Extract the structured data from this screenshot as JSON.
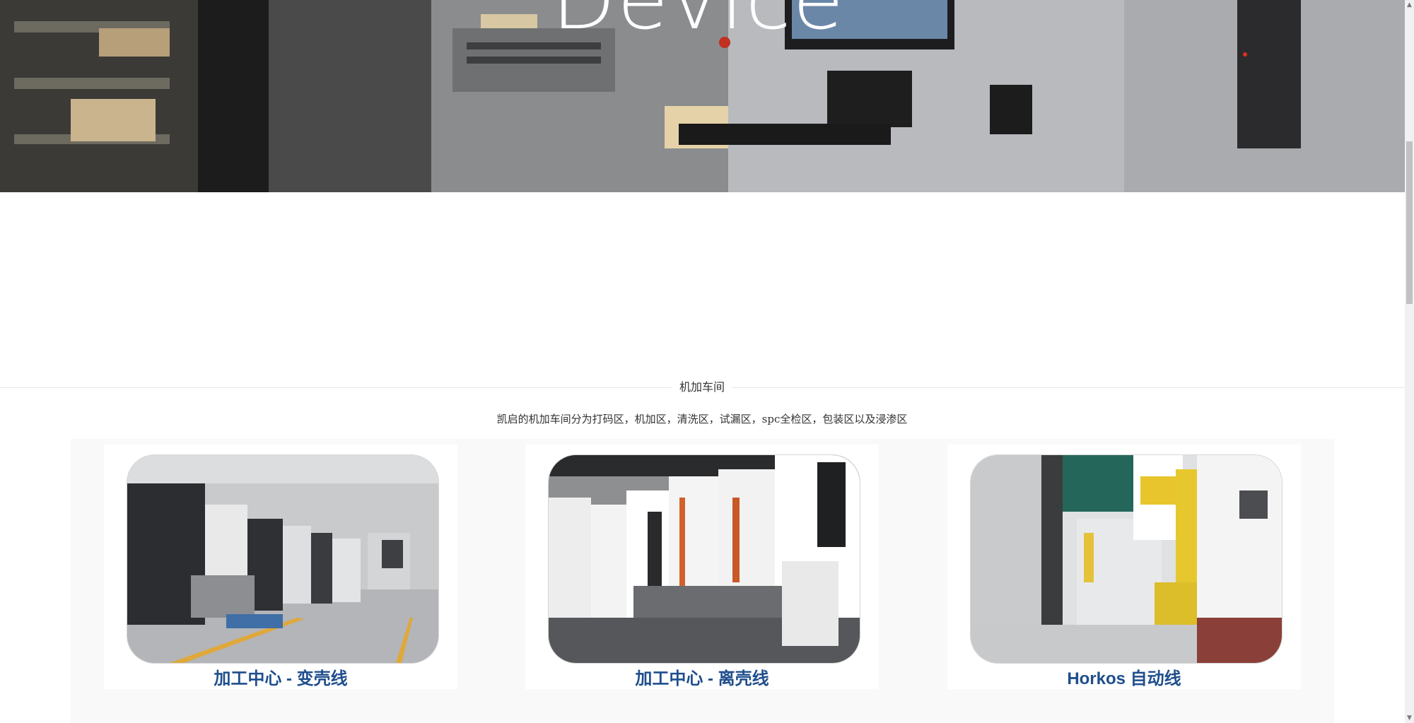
{
  "hero": {
    "title": "Device"
  },
  "section": {
    "title": "机加车间",
    "description": "凯启的机加车间分为打码区，机加区，清洗区，试漏区，spc全检区，包装区以及浸渗区"
  },
  "gallery": {
    "items": [
      {
        "caption": "加工中心 - 变壳线",
        "image": "factory-floor-cnc-machines"
      },
      {
        "caption": "加工中心 - 离壳线",
        "image": "cnc-machining-centers"
      },
      {
        "caption": "Horkos 自动线",
        "image": "yellow-robot-automation-line"
      }
    ]
  },
  "colors": {
    "caption": "#1f4e8c",
    "gallery_bg": "#f9f9f9",
    "divider": "#e6e6e6"
  }
}
